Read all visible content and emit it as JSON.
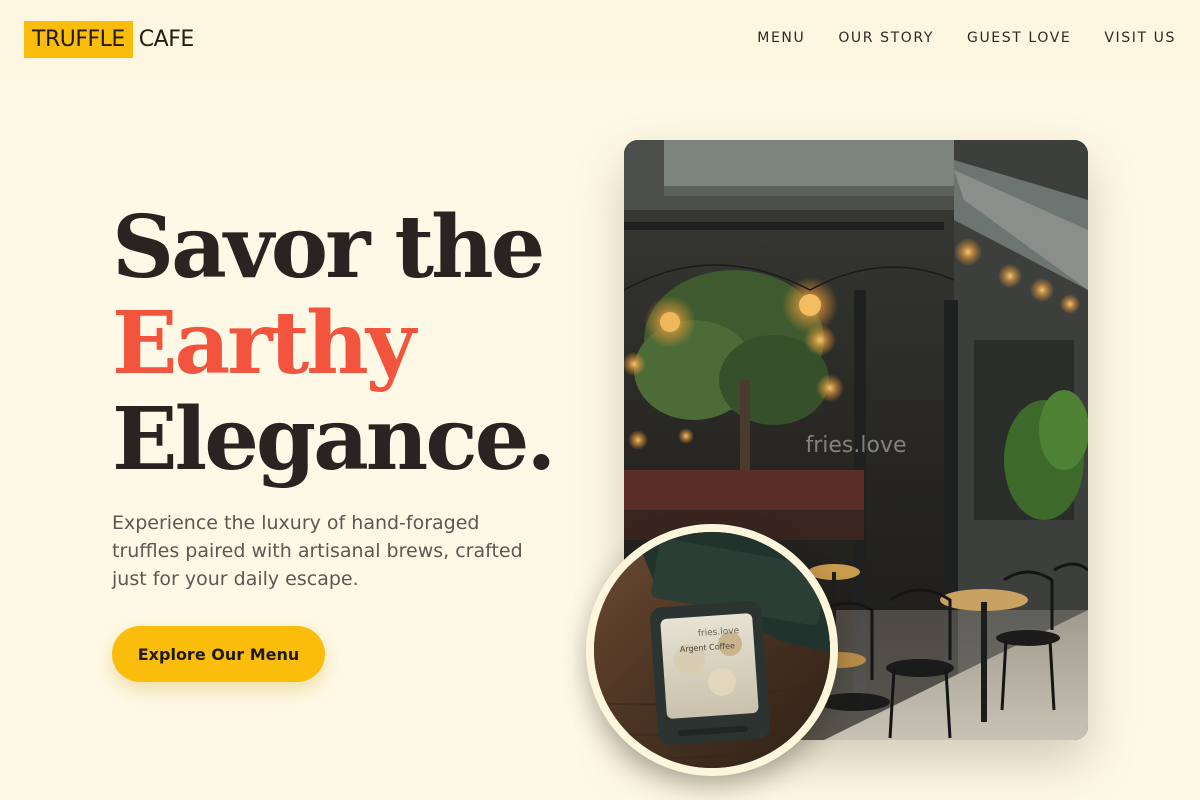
{
  "brand": {
    "highlight": "TRUFFLE",
    "rest": "CAFE",
    "accent_color": "#fbbd0c"
  },
  "nav": {
    "items": [
      {
        "label": "MENU"
      },
      {
        "label": "OUR STORY"
      },
      {
        "label": "GUEST LOVE"
      },
      {
        "label": "VISIT US"
      }
    ]
  },
  "hero": {
    "title_line_1": "Savor the",
    "title_line_2": "Earthy",
    "title_line_3": "Elegance.",
    "title_accent_color": "#f2543d",
    "description": "Experience the luxury of hand-foraged truffles paired with artisanal brews, crafted just for your daily escape.",
    "cta_label": "Explore Our Menu"
  },
  "images": {
    "main_watermark": "fries.love",
    "inset_screen_lines": [
      "fries.love",
      "Argent Coffee"
    ]
  }
}
